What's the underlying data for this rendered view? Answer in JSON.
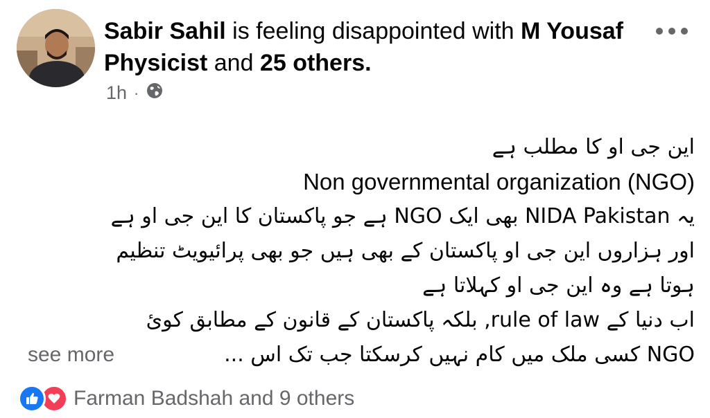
{
  "post": {
    "author": "Sabir Sahil",
    "feeling_text": " is feeling disappointed with ",
    "tagged_person": "M Yousaf Physicist",
    "conjunction": " and ",
    "others": "25 others.",
    "time": "1h",
    "separator": "·",
    "privacy_icon": "globe-icon",
    "body_lines": [
      "این جی او کا مطلب ہے",
      "Non governmental organization (NGO)",
      "یہ NIDA Pakistan بھی ایک NGO ہے جو پاکستان کا این جی او ہے",
      "اور ہزاروں این جی او پاکستان کے بھی ہیں جو بھی پرائیویٹ تنظیم",
      "ہوتا ہے وہ این جی او کہلاتا ہے",
      "اب دنیا کے rule of law, بلکہ پاکستان کے قانون کے مطابق کوئ",
      "NGO کسی ملک میں کام نہیں کرسکتا جب تک اس ..."
    ],
    "see_more": "see more"
  },
  "reactions": {
    "icons": [
      "like-icon",
      "love-icon"
    ],
    "names": "Farman Badshah and 9 others"
  },
  "colors": {
    "text": "#050505",
    "secondary": "#65676b",
    "like": "#1877f2",
    "love": "#f33e58"
  }
}
